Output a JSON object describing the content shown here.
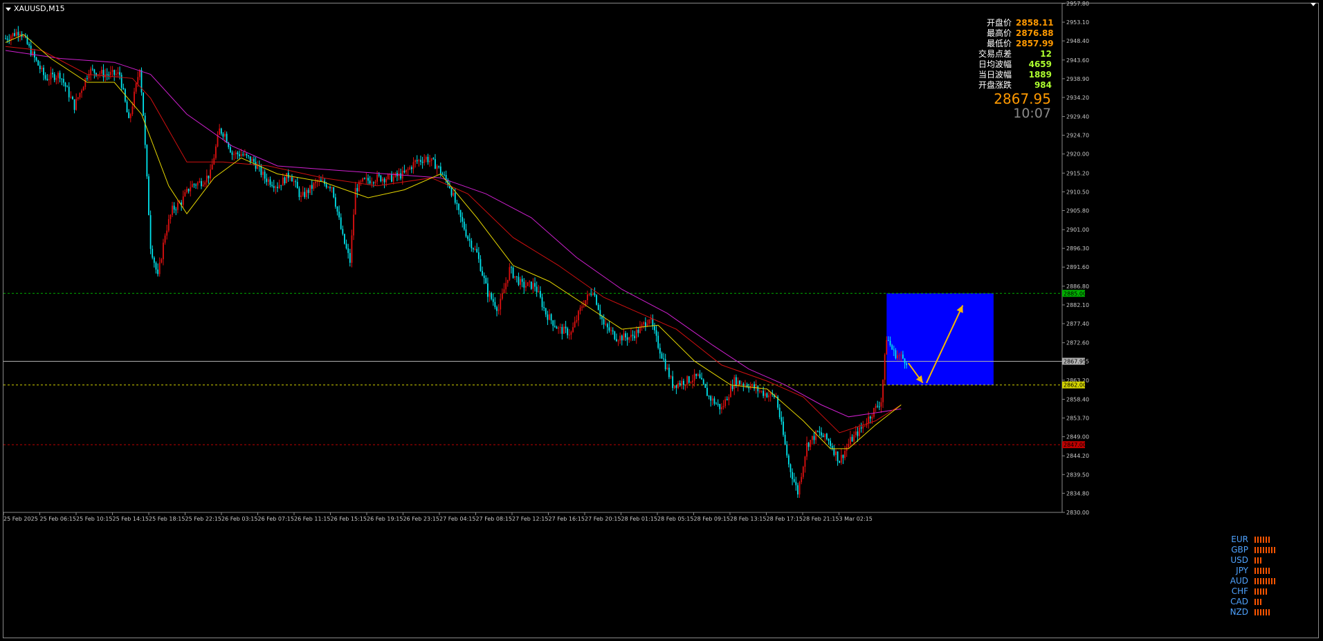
{
  "symbol": "XAUUSD,M15",
  "info": [
    {
      "key": "开盘价",
      "value": "2858.11",
      "color": "#ff9900"
    },
    {
      "key": "最高价",
      "value": "2876.88",
      "color": "#ff9900"
    },
    {
      "key": "最低价",
      "value": "2857.99",
      "color": "#ff9900"
    },
    {
      "key": "交易点差",
      "value": "12",
      "color": "#adff2f"
    },
    {
      "key": "日均波幅",
      "value": "4659",
      "color": "#adff2f"
    },
    {
      "key": "当日波幅",
      "value": "1889",
      "color": "#adff2f"
    },
    {
      "key": "开盘涨跌",
      "value": "984",
      "color": "#adff2f"
    }
  ],
  "current_price": "2867.95",
  "current_time": "10:07",
  "currencies": [
    {
      "name": "EUR",
      "strength": 6
    },
    {
      "name": "GBP",
      "strength": 8
    },
    {
      "name": "USD",
      "strength": 3
    },
    {
      "name": "JPY",
      "strength": 6
    },
    {
      "name": "AUD",
      "strength": 8
    },
    {
      "name": "CHF",
      "strength": 5
    },
    {
      "name": "CAD",
      "strength": 3
    },
    {
      "name": "NZD",
      "strength": 6
    }
  ],
  "chart_data": {
    "type": "candlestick",
    "ylim": [
      2830.0,
      2957.8
    ],
    "y_ticks": [
      "2957.80",
      "2953.10",
      "2948.40",
      "2943.60",
      "2938.90",
      "2934.20",
      "2929.40",
      "2924.70",
      "2920.00",
      "2915.20",
      "2910.50",
      "2905.80",
      "2901.00",
      "2896.30",
      "2891.60",
      "2886.80",
      "2882.10",
      "2877.40",
      "2872.60",
      "2867.95",
      "2863.20",
      "2858.40",
      "2853.70",
      "2849.00",
      "2844.20",
      "2839.50",
      "2834.80",
      "2830.00"
    ],
    "x_ticks": [
      "25 Feb 2025",
      "25 Feb 06:15",
      "25 Feb 10:15",
      "25 Feb 14:15",
      "25 Feb 18:15",
      "25 Feb 22:15",
      "26 Feb 03:15",
      "26 Feb 07:15",
      "26 Feb 11:15",
      "26 Feb 15:15",
      "26 Feb 19:15",
      "26 Feb 23:15",
      "27 Feb 04:15",
      "27 Feb 08:15",
      "27 Feb 12:15",
      "27 Feb 16:15",
      "27 Feb 20:15",
      "28 Feb 01:15",
      "28 Feb 05:15",
      "28 Feb 09:15",
      "28 Feb 13:15",
      "28 Feb 17:15",
      "28 Feb 21:15",
      "3 Mar 02:15"
    ],
    "price_path": [
      [
        0,
        2949
      ],
      [
        8,
        2951
      ],
      [
        16,
        2944
      ],
      [
        22,
        2939
      ],
      [
        30,
        2940
      ],
      [
        38,
        2932
      ],
      [
        46,
        2941
      ],
      [
        55,
        2940
      ],
      [
        63,
        2940
      ],
      [
        68,
        2928
      ],
      [
        72,
        2937
      ],
      [
        74,
        2942
      ],
      [
        76,
        2930
      ],
      [
        80,
        2897
      ],
      [
        84,
        2889
      ],
      [
        88,
        2900
      ],
      [
        92,
        2906
      ],
      [
        97,
        2908
      ],
      [
        102,
        2912
      ],
      [
        108,
        2913
      ],
      [
        113,
        2915
      ],
      [
        118,
        2926
      ],
      [
        121,
        2925
      ],
      [
        125,
        2920
      ],
      [
        130,
        2920
      ],
      [
        137,
        2918
      ],
      [
        143,
        2914
      ],
      [
        150,
        2912
      ],
      [
        157,
        2915
      ],
      [
        163,
        2909
      ],
      [
        172,
        2913
      ],
      [
        180,
        2912
      ],
      [
        186,
        2899
      ],
      [
        190,
        2893
      ],
      [
        193,
        2911
      ],
      [
        197,
        2913
      ],
      [
        205,
        2914
      ],
      [
        213,
        2914
      ],
      [
        220,
        2915
      ],
      [
        226,
        2918
      ],
      [
        232,
        2919
      ],
      [
        238,
        2917
      ],
      [
        245,
        2912
      ],
      [
        250,
        2905
      ],
      [
        255,
        2899
      ],
      [
        260,
        2895
      ],
      [
        266,
        2885
      ],
      [
        272,
        2881
      ],
      [
        278,
        2891
      ],
      [
        285,
        2887
      ],
      [
        292,
        2887
      ],
      [
        298,
        2880
      ],
      [
        305,
        2876
      ],
      [
        312,
        2875
      ],
      [
        318,
        2882
      ],
      [
        324,
        2886
      ],
      [
        330,
        2877
      ],
      [
        337,
        2874
      ],
      [
        345,
        2874
      ],
      [
        350,
        2876
      ],
      [
        355,
        2879
      ],
      [
        360,
        2872
      ],
      [
        368,
        2862
      ],
      [
        375,
        2863
      ],
      [
        382,
        2864
      ],
      [
        388,
        2859
      ],
      [
        395,
        2856
      ],
      [
        402,
        2863
      ],
      [
        410,
        2862
      ],
      [
        418,
        2860
      ],
      [
        425,
        2859
      ],
      [
        432,
        2842
      ],
      [
        437,
        2835
      ],
      [
        442,
        2847
      ],
      [
        448,
        2850
      ],
      [
        454,
        2848
      ],
      [
        460,
        2843
      ],
      [
        466,
        2848
      ],
      [
        472,
        2851
      ],
      [
        478,
        2855
      ],
      [
        483,
        2858
      ],
      [
        486,
        2874
      ],
      [
        490,
        2870
      ],
      [
        494,
        2869
      ],
      [
        497,
        2868
      ]
    ],
    "ma_yellow": [
      [
        0,
        2948
      ],
      [
        10,
        2950
      ],
      [
        25,
        2944
      ],
      [
        45,
        2938
      ],
      [
        60,
        2938
      ],
      [
        75,
        2930
      ],
      [
        90,
        2912
      ],
      [
        100,
        2905
      ],
      [
        115,
        2914
      ],
      [
        130,
        2919
      ],
      [
        150,
        2915
      ],
      [
        175,
        2913
      ],
      [
        200,
        2909
      ],
      [
        220,
        2911
      ],
      [
        240,
        2915
      ],
      [
        260,
        2904
      ],
      [
        280,
        2892
      ],
      [
        300,
        2888
      ],
      [
        320,
        2882
      ],
      [
        340,
        2876
      ],
      [
        360,
        2877
      ],
      [
        380,
        2868
      ],
      [
        400,
        2862
      ],
      [
        420,
        2861
      ],
      [
        440,
        2853
      ],
      [
        455,
        2846
      ],
      [
        465,
        2846
      ],
      [
        480,
        2852
      ],
      [
        494,
        2857
      ]
    ],
    "ma_red": [
      [
        0,
        2947
      ],
      [
        20,
        2946
      ],
      [
        45,
        2940
      ],
      [
        70,
        2939
      ],
      [
        80,
        2934
      ],
      [
        100,
        2918
      ],
      [
        120,
        2918
      ],
      [
        145,
        2917
      ],
      [
        175,
        2914
      ],
      [
        205,
        2912
      ],
      [
        235,
        2914
      ],
      [
        255,
        2910
      ],
      [
        280,
        2899
      ],
      [
        305,
        2892
      ],
      [
        330,
        2884
      ],
      [
        350,
        2880
      ],
      [
        370,
        2876
      ],
      [
        395,
        2867
      ],
      [
        420,
        2863
      ],
      [
        440,
        2859
      ],
      [
        460,
        2850
      ],
      [
        480,
        2853
      ],
      [
        494,
        2857
      ]
    ],
    "ma_magenta": [
      [
        0,
        2946
      ],
      [
        30,
        2944
      ],
      [
        60,
        2943
      ],
      [
        80,
        2940
      ],
      [
        100,
        2930
      ],
      [
        125,
        2922
      ],
      [
        150,
        2917
      ],
      [
        180,
        2916
      ],
      [
        210,
        2915
      ],
      [
        240,
        2914
      ],
      [
        265,
        2910
      ],
      [
        290,
        2904
      ],
      [
        315,
        2894
      ],
      [
        340,
        2886
      ],
      [
        365,
        2880
      ],
      [
        390,
        2872
      ],
      [
        410,
        2866
      ],
      [
        430,
        2862
      ],
      [
        450,
        2857
      ],
      [
        465,
        2854
      ],
      [
        480,
        2855
      ],
      [
        494,
        2856
      ]
    ],
    "levels": [
      {
        "price": 2885.0,
        "label": "2885.00",
        "color": "#00b000",
        "style": "dashed"
      },
      {
        "price": 2867.95,
        "label": "2867.95",
        "color": "#b0b0b0",
        "style": "solid"
      },
      {
        "price": 2862.0,
        "label": "2862.00",
        "color": "#d4d400",
        "style": "dashed"
      },
      {
        "price": 2847.0,
        "label": "2847.00",
        "color": "#c00000",
        "style": "dashed"
      }
    ],
    "zone": {
      "bar_start": 486,
      "bar_end": 545,
      "price_top": 2885.0,
      "price_bottom": 2862.0,
      "color": "#0000ff"
    },
    "arrows": [
      {
        "from": [
          498,
          2867.5
        ],
        "to": [
          506,
          2862.5
        ],
        "color": "#f5b800"
      },
      {
        "from": [
          508,
          2862.5
        ],
        "to": [
          528,
          2882.0
        ],
        "color": "#f5b800"
      }
    ]
  }
}
